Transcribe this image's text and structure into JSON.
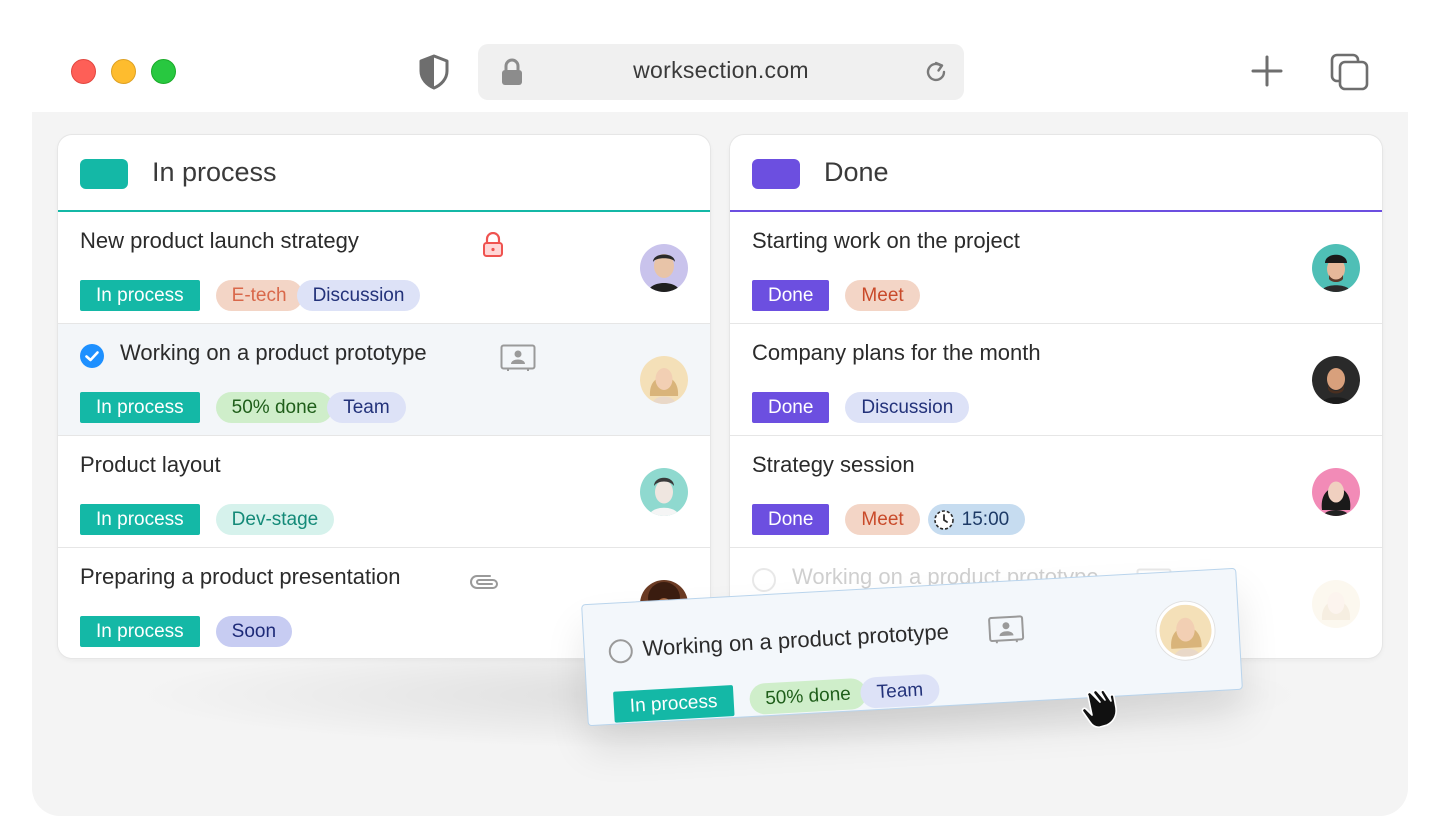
{
  "browser": {
    "url": "worksection.com",
    "icons": [
      "shield-icon",
      "lock-icon",
      "reload-icon",
      "new-tab-plus-icon",
      "tabs-overview-icon"
    ]
  },
  "colors": {
    "in_process": "#14b8a6",
    "done": "#6c4fe0",
    "check_blue": "#1e90ff"
  },
  "columns": [
    {
      "title": "In process",
      "cards": [
        {
          "title": "New product launch strategy",
          "status": "In process",
          "tags": [
            "E-tech",
            "Discussion"
          ],
          "icon": "lock-icon"
        },
        {
          "title": "Working on a product prototype",
          "status": "In process",
          "tags": [
            "50% done",
            "Team"
          ],
          "icon": "contact-card-icon",
          "checked": true
        },
        {
          "title": "Product layout",
          "status": "In process",
          "tags": [
            "Dev-stage"
          ]
        },
        {
          "title": "Preparing a product presentation",
          "status": "In process",
          "tags": [
            "Soon"
          ],
          "icon": "paperclip-icon"
        }
      ]
    },
    {
      "title": "Done",
      "cards": [
        {
          "title": "Starting work on the project",
          "status": "Done",
          "tags": [
            "Meet"
          ]
        },
        {
          "title": "Company plans for the month",
          "status": "Done",
          "tags": [
            "Discussion"
          ]
        },
        {
          "title": "Strategy session",
          "status": "Done",
          "tags": [
            "Meet",
            "15:00"
          ],
          "icon": "clock-icon"
        },
        {
          "title": "Working on a product prototype",
          "status": "",
          "tags": [],
          "placeholder": true
        }
      ]
    }
  ],
  "dragged_card": {
    "title": "Working on a product prototype",
    "status": "In process",
    "tags": [
      "50% done",
      "Team"
    ]
  }
}
